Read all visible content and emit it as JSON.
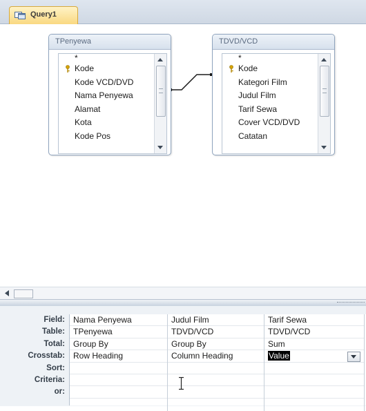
{
  "tab": {
    "label": "Query1",
    "icon": "query-icon"
  },
  "tables": [
    {
      "title": "TPenyewa",
      "fields": [
        "*",
        "Kode",
        "Kode VCD/DVD",
        "Nama Penyewa",
        "Alamat",
        "Kota",
        "Kode Pos"
      ],
      "key_field": "Kode"
    },
    {
      "title": "TDVD/VCD",
      "fields": [
        "*",
        "Kode",
        "Kategori Film",
        "Judul Film",
        "Tarif Sewa",
        "Cover VCD/DVD",
        "Catatan"
      ],
      "key_field": "Kode"
    }
  ],
  "grid": {
    "row_labels": [
      "Field:",
      "Table:",
      "Total:",
      "Crosstab:",
      "Sort:",
      "Criteria:",
      "or:"
    ],
    "columns": [
      {
        "field": "Nama Penyewa",
        "table": "TPenyewa",
        "total": "Group By",
        "crosstab": "Row Heading",
        "sort": "",
        "criteria": "",
        "or": ""
      },
      {
        "field": "Judul Film",
        "table": "TDVD/VCD",
        "total": "Group By",
        "crosstab": "Column Heading",
        "sort": "",
        "criteria": "",
        "or": ""
      },
      {
        "field": "Tarif Sewa",
        "table": "TDVD/VCD",
        "total": "Sum",
        "crosstab": "Value",
        "sort": "",
        "criteria": "",
        "or": ""
      }
    ]
  },
  "colors": {
    "tab_bg": "#f9d77e",
    "selection": "#000000",
    "panel_border": "#8ea3bd"
  }
}
